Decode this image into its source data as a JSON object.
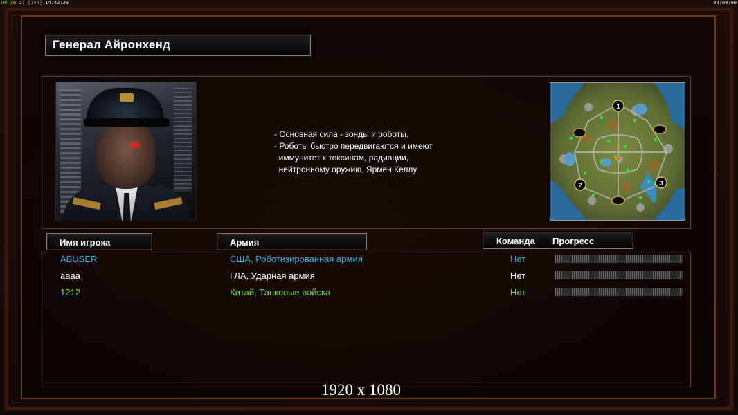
{
  "debug_bar": {
    "ur": "UR",
    "fps": "30",
    "logic": "27",
    "frames": "[144]",
    "clock": "14:42:39",
    "timer": "00:00:00"
  },
  "general": {
    "title": "Генерал Айронхенд",
    "description": [
      "- Основная сила - зонды и роботы.",
      "- Роботы быстро передвигаются и имеют",
      "  иммунитет к токсинам, радиации,",
      "  нейтронному оружию, Ярмен Келлу"
    ]
  },
  "minimap": {
    "start_positions": [
      "1",
      "2",
      "3"
    ]
  },
  "columns": {
    "player_name": "Имя игрока",
    "army": "Армия",
    "team": "Команда",
    "progress": "Прогресс"
  },
  "players": [
    {
      "name": "ABUSER",
      "army": "США, Роботизированная армия",
      "team": "Нет",
      "color": "#3ab4ea",
      "progress": 0
    },
    {
      "name": "аааа",
      "army": "ГЛА, Ударная армия",
      "team": "Нет",
      "color": "#ffffff",
      "progress": 0
    },
    {
      "name": "1212",
      "army": "Китай, Танковые войска",
      "team": "Нет",
      "color": "#7ee02a",
      "progress": 0
    }
  ],
  "resolution_label": "1920 x 1080",
  "colors": {
    "frame": "#6b3818",
    "plate_border": "#8a7a5e"
  }
}
